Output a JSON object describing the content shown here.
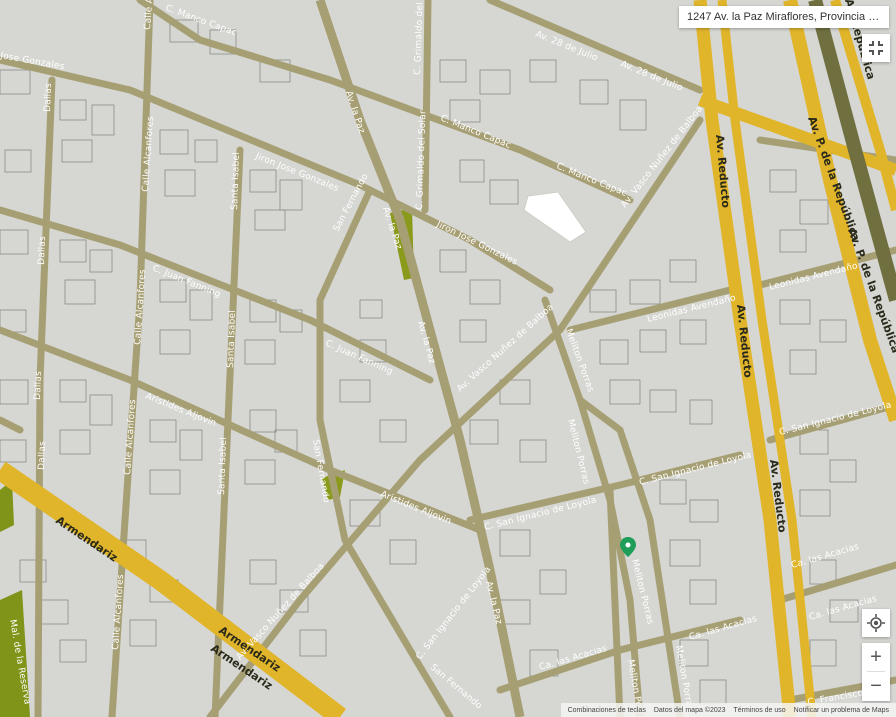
{
  "address_bar": {
    "text": "1247 Av. la Paz Miraflores, Provincia de ..."
  },
  "controls": {
    "fullscreen_icon": "fullscreen-exit-icon",
    "locate_icon": "my-location-icon",
    "zoom_in": "+",
    "zoom_out": "−"
  },
  "footer": {
    "shortcuts": "Combinaciones de teclas",
    "map_data": "Datos del mapa ©2023",
    "terms": "Términos de uso",
    "report": "Notificar un problema de Maps"
  },
  "colors": {
    "major_road": "#e0b52a",
    "street": "#a79f74",
    "land": "#d6d6d2",
    "park": "#8a9a1a",
    "pin": "#1e9e58"
  },
  "labels": {
    "av_republica": "Av. República",
    "av_28_julio_1": "Av. 28 de Julio",
    "av_28_julio_2": "Av. 28 de Julio",
    "av_reducto_1": "Av. Reducto",
    "av_reducto_2": "Av. Reducto",
    "av_reducto_3": "Av. Reducto",
    "av_pdlr_1": "Av. P. de la República",
    "av_pdlr_2": "Av. P. de la República",
    "armendariz_1": "Armendariz",
    "armendariz_2": "Armendariz",
    "armendariz_3": "Armendariz",
    "manco_capac_1": "C. Manco Capac",
    "manco_capac_2": "C. Manco Capac",
    "manco_capac_3": "C. Manco Capac",
    "jose_gonzales_1": "Jiron Jose Gonzales",
    "jose_gonzales_2": "Jiron Jose Gonzales",
    "jose_gonzales_3": "Jose Gonzales",
    "juan_fanning_1": "C. Juan Fanning",
    "juan_fanning_2": "C. Juan Fanning",
    "aristides_1": "Aristides Aljovin",
    "aristides_2": "Aristides Aljovin",
    "av_la_paz_1": "Av. la Paz",
    "av_la_paz_2": "Av. la Paz",
    "av_la_paz_3": "Av. la Paz",
    "av_la_paz_4": "Av. la Paz",
    "vasco_1": "Av. Vasco Nuñez de Balboa",
    "vasco_2": "Av. Vasco Nuñez de Balboa",
    "vasco_3": "Av. Vasco Nuñez de Balboa",
    "leonidas_1": "Leonidas Avendaño",
    "leonidas_2": "Leonidas Avendaño",
    "san_ignacio_1": "C. San Ignacio de Loyola",
    "san_ignacio_2": "C. San Ignacio de Loyola",
    "san_ignacio_3": "C. San Ignacio de Loyola",
    "san_ignacio_4": "C. San Ignacio de Loyola",
    "san_fernando_1": "San Fernando",
    "san_fernando_2": "San Fernando",
    "san_fernando_3": "San Fernando",
    "melitón_1": "Meliton Porras",
    "melitón_2": "Meliton Porras",
    "melitón_3": "Meliton Porras",
    "melitón_4": "Meliton Porras",
    "melitón_5": "Meliton Porras",
    "las_acacias_1": "Ca. las Acacias",
    "las_acacias_2": "Ca. las Acacias",
    "las_acacias_3": "Ca. las Acacias",
    "las_acacias_4": "Ca. las Acacias",
    "alcanfores_1": "Calle Alcanfores",
    "alcanfores_2": "Calle Alcanfores",
    "alcanfores_3": "Calle Alcanfores",
    "alcanfores_4": "Calle Alcanfores",
    "alcanfores_5": "Calle Alcanfores",
    "santa_isabel_1": "Santa Isabel",
    "santa_isabel_2": "Santa Isabel",
    "santa_isabel_3": "Santa Isabel",
    "dallas_1": "Dallas",
    "dallas_2": "Dallas",
    "dallas_3": "Dallas",
    "dallas_4": "Dallas",
    "grimaldo_1": "C. Grimaldo del Solar",
    "grimaldo_2": "C. Grimaldo del Solar",
    "francisco": "C. Francisco P.",
    "mal_de_la_reserva": "Mal. de la Reserva",
    "jose_gonzales_left": "Jose Gonzales"
  }
}
